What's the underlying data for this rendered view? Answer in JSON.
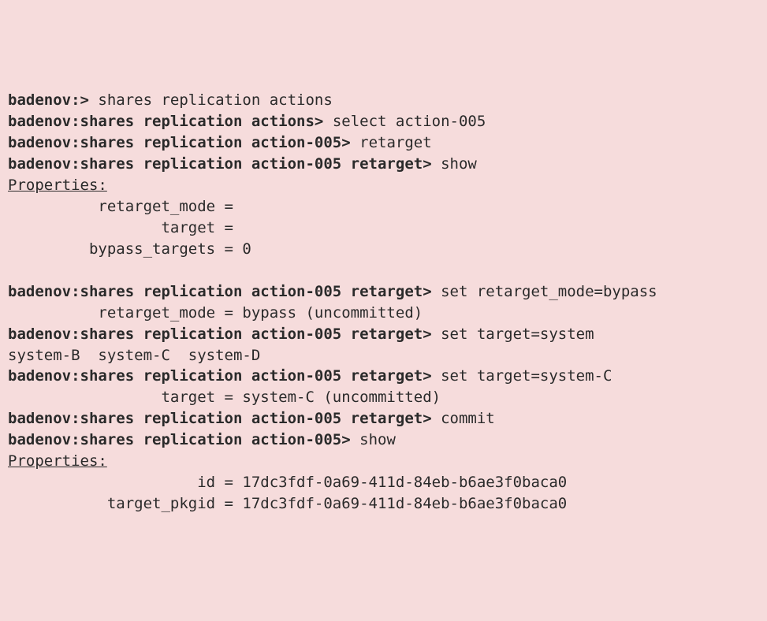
{
  "lines": [
    {
      "prompt": "badenov:>",
      "cmd": " shares replication actions"
    },
    {
      "prompt": "badenov:shares replication actions>",
      "cmd": " select action-005"
    },
    {
      "prompt": "badenov:shares replication action-005>",
      "cmd": " retarget"
    },
    {
      "prompt": "badenov:shares replication action-005 retarget>",
      "cmd": " show"
    },
    {
      "text": "Properties:",
      "underline": true
    },
    {
      "text": "          retarget_mode ="
    },
    {
      "text": "                 target ="
    },
    {
      "text": "         bypass_targets = 0"
    },
    {
      "text": " "
    },
    {
      "prompt": "badenov:shares replication action-005 retarget>",
      "cmd": " set retarget_mode=bypass"
    },
    {
      "text": "          retarget_mode = bypass (uncommitted)"
    },
    {
      "prompt": "badenov:shares replication action-005 retarget>",
      "cmd": " set target=system"
    },
    {
      "text": "system-B  system-C  system-D"
    },
    {
      "prompt": "badenov:shares replication action-005 retarget>",
      "cmd": " set target=system-C"
    },
    {
      "text": "                 target = system-C (uncommitted)"
    },
    {
      "prompt": "badenov:shares replication action-005 retarget>",
      "cmd": " commit"
    },
    {
      "prompt": "badenov:shares replication action-005>",
      "cmd": " show"
    },
    {
      "text": "Properties:",
      "underline": true
    },
    {
      "text": "                     id = 17dc3fdf-0a69-411d-84eb-b6ae3f0baca0"
    },
    {
      "text": "           target_pkgid = 17dc3fdf-0a69-411d-84eb-b6ae3f0baca0"
    }
  ]
}
